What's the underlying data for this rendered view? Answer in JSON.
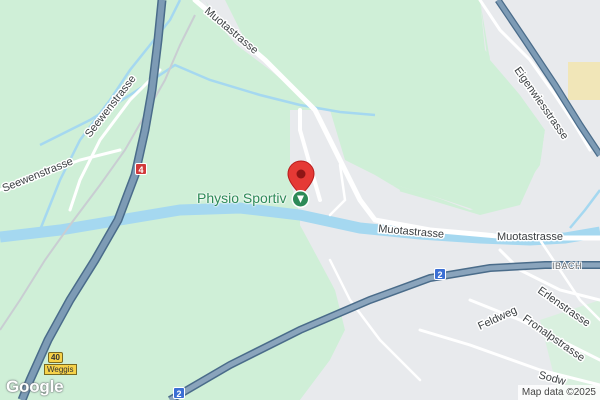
{
  "map": {
    "colors": {
      "forest": "#cfefd7",
      "urban": "#e8eaed",
      "water": "#a5d8f0",
      "road_minor": "#ffffff",
      "highway": "#6f8ea8",
      "highway_edge": "#4a6c8a",
      "poi_green": "#2d8a57",
      "marker_red": "#e53935"
    },
    "streets": {
      "muotastrasse_north": "Muotastrasse",
      "muotastrasse_center": "Muotastrasse",
      "muotastrasse_east": "Muotastrasse",
      "seewenstrasse_north": "Seewenstrasse",
      "seewenstrasse_west": "Seewenstrasse",
      "eigenwiesstrasse": "Eigenwiesstrasse",
      "erlenstrasse": "Erlenstrasse",
      "fronalpstrasse": "Fronalpstrasse",
      "feldweg": "Feldweg",
      "sodw": "Sodw"
    },
    "localities": {
      "ibach": "IBACH"
    },
    "route_shields": {
      "a4": "4",
      "r2_east": "2",
      "r2_south": "2",
      "r40": "40"
    },
    "place_labels": {
      "weggis": "Weggis"
    },
    "poi": {
      "name": "Physio Sportiv",
      "icon": "medical-icon"
    },
    "marker": {
      "icon": "map-pin-icon"
    },
    "logo": "Google",
    "attribution": "Map data ©2025"
  }
}
